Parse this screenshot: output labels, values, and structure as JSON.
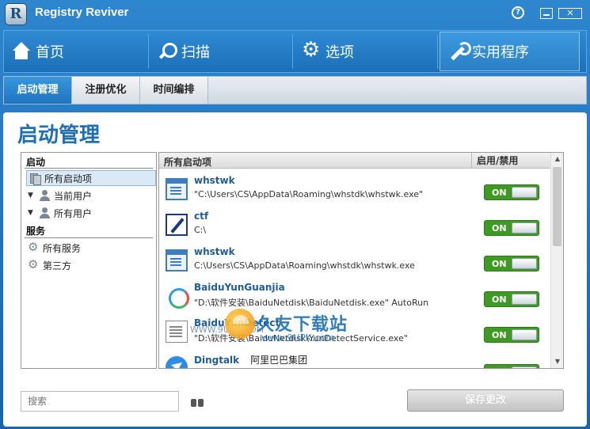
{
  "app": {
    "title": "Registry Reviver",
    "logo_letter": "R",
    "help_label": "?",
    "close_label": "✕"
  },
  "nav": [
    {
      "label": "首页",
      "icon": "home-icon"
    },
    {
      "label": "扫描",
      "icon": "search-icon"
    },
    {
      "label": "选项",
      "icon": "gear-icon"
    },
    {
      "label": "实用程序",
      "icon": "wrench-icon",
      "active": true
    }
  ],
  "subtabs": [
    {
      "label": "启动管理",
      "active": true
    },
    {
      "label": "注册优化"
    },
    {
      "label": "时间编排"
    }
  ],
  "page_title": "启动管理",
  "tree": {
    "section_startup": "启动",
    "all_startup": "所有启动项",
    "current_user": "当前用户",
    "all_users": "所有用户",
    "section_services": "服务",
    "all_services": "所有服务",
    "third_party": "第三方"
  },
  "list": {
    "col_items": "所有启动项",
    "col_toggle": "启用/禁用",
    "rows": [
      {
        "name": "whstwk",
        "path": "\"C:\\Users\\CS\\AppData\\Roaming\\whstdk\\whstwk.exe\"",
        "extra": "",
        "state": "ON",
        "icon": "window-icon"
      },
      {
        "name": "ctf",
        "path": "C:\\",
        "extra": "",
        "state": "ON",
        "icon": "pencil-icon"
      },
      {
        "name": "whstwk",
        "path": "C:\\Users\\CS\\AppData\\Roaming\\whstdk\\whstwk.exe",
        "extra": "",
        "state": "ON",
        "icon": "window-icon"
      },
      {
        "name": "BaiduYunGuanjia",
        "path": "\"D:\\软件安装\\BaiduNetdisk\\BaiduNetdisk.exe\" AutoRun",
        "extra": "",
        "state": "ON",
        "icon": "baidu-cloud-icon"
      },
      {
        "name": "BaiduYunDetect",
        "path": "\"D:\\软件安装\\BaiduNetdisk\\YunDetectService.exe\"",
        "extra": "",
        "state": "ON",
        "icon": "document-icon"
      },
      {
        "name": "Dingtalk",
        "path": "",
        "extra": "阿里巴巴集团",
        "state": "ON",
        "icon": "dingtalk-icon"
      }
    ]
  },
  "watermark": {
    "cn": "久友下载站",
    "url": "www.9UPK.com",
    "left": "WWW.9UPK.COM"
  },
  "footer": {
    "search_placeholder": "搜索",
    "save_label": "保存更改"
  }
}
